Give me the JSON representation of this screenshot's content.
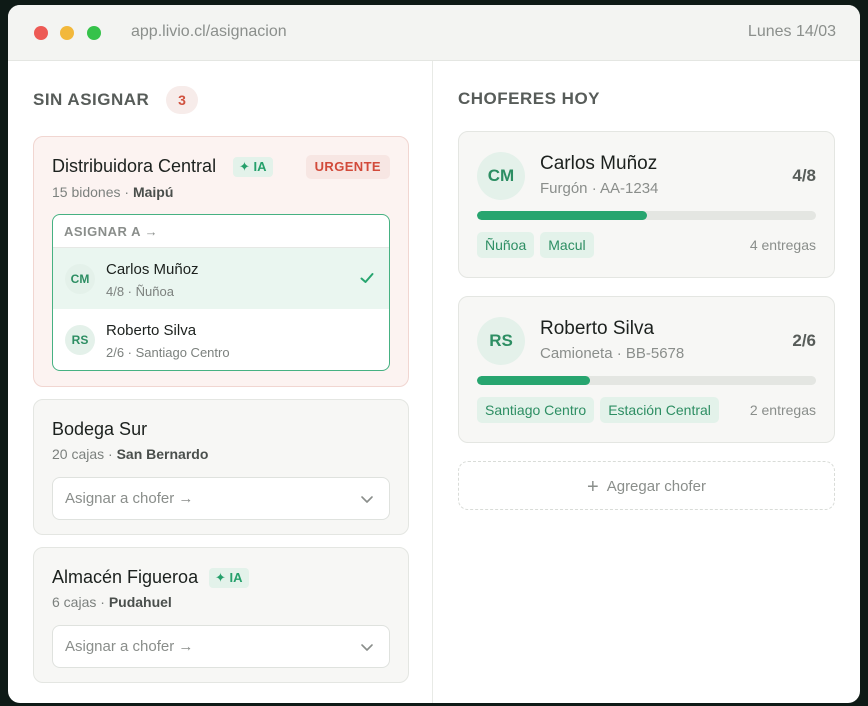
{
  "window": {
    "url": "app.livio.cl/asignacion",
    "date": "Lunes 14/03"
  },
  "unassigned": {
    "title": "SIN ASIGNAR",
    "count": "3",
    "orders": [
      {
        "name": "Distribuidora Central",
        "ia_label": "✦ IA",
        "urgent_label": "URGENTE",
        "quantity": "15 bidones · ",
        "area": "Maipú",
        "dropdown": {
          "header": "ASIGNAR A →",
          "options": [
            {
              "initials": "CM",
              "name": "Carlos Muñoz",
              "detail": "4/8 · Ñuñoa",
              "selected": true
            },
            {
              "initials": "RS",
              "name": "Roberto Silva",
              "detail": "2/6 · Santiago Centro",
              "selected": false
            }
          ]
        }
      },
      {
        "name": "Bodega Sur",
        "quantity": "20 cajas · ",
        "area": "San Bernardo",
        "select_placeholder": "Asignar a chofer →"
      },
      {
        "name": "Almacén Figueroa",
        "ia_label": "✦ IA",
        "quantity": "6 cajas · ",
        "area": "Pudahuel",
        "select_placeholder": "Asignar a chofer →"
      }
    ]
  },
  "drivers": {
    "title": "CHOFERES HOY",
    "items": [
      {
        "initials": "CM",
        "name": "Carlos Muñoz",
        "vehicle": "Furgón · AA-1234",
        "load": "4/8",
        "load_fraction": 0.5,
        "zones": [
          "Ñuñoa",
          "Macul"
        ],
        "deliveries": "4 entregas"
      },
      {
        "initials": "RS",
        "name": "Roberto Silva",
        "vehicle": "Camioneta · BB-5678",
        "load": "2/6",
        "load_fraction": 0.333,
        "zones": [
          "Santiago Centro",
          "Estación Central"
        ],
        "deliveries": "2 entregas"
      }
    ],
    "add_label": "Agregar chofer"
  },
  "colors": {
    "accent": "#27a56f",
    "urgent": "#d24a3a"
  },
  "icons": {
    "check": "check-icon",
    "chevron": "chevron-down-icon",
    "plus": "plus-icon"
  }
}
